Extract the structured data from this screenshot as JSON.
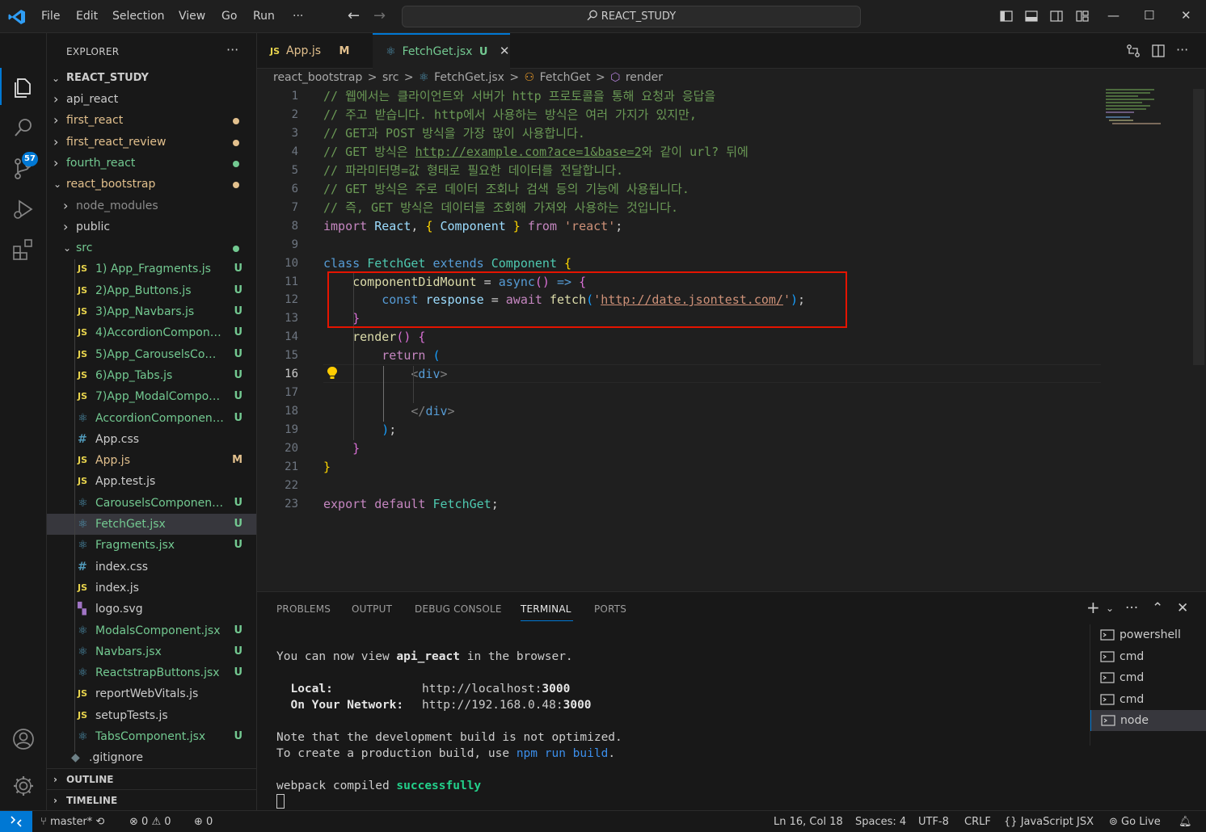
{
  "titlebar": {
    "menu": [
      "File",
      "Edit",
      "Selection",
      "View",
      "Go",
      "Run",
      "···"
    ],
    "search_text": "REACT_STUDY"
  },
  "activity": {
    "source_control_badge": "57"
  },
  "sidebar": {
    "title": "EXPLORER",
    "more": "···",
    "root": "REACT_STUDY",
    "tree": [
      {
        "label": "api_react",
        "type": "folder",
        "depth": 1,
        "expanded": false,
        "status": "",
        "dot": ""
      },
      {
        "label": "first_react",
        "type": "folder",
        "depth": 1,
        "expanded": false,
        "status": "",
        "dot": "#e2c08d"
      },
      {
        "label": "first_react_review",
        "type": "folder",
        "depth": 1,
        "expanded": false,
        "status": "",
        "dot": "#e2c08d"
      },
      {
        "label": "fourth_react",
        "type": "folder",
        "depth": 1,
        "expanded": false,
        "status": "",
        "dot": "#73c991"
      },
      {
        "label": "react_bootstrap",
        "type": "folder",
        "depth": 1,
        "expanded": true,
        "status": "",
        "dot": "#e2c08d"
      },
      {
        "label": "node_modules",
        "type": "folder",
        "depth": 2,
        "expanded": false,
        "status": "",
        "dot": "",
        "dim": true
      },
      {
        "label": "public",
        "type": "folder",
        "depth": 2,
        "expanded": false,
        "status": "",
        "dot": ""
      },
      {
        "label": "src",
        "type": "folder",
        "depth": 2,
        "expanded": true,
        "status": "",
        "dot": "#73c991"
      },
      {
        "label": "1) App_Fragments.js",
        "type": "js",
        "depth": 3,
        "status": "U"
      },
      {
        "label": "2)App_Buttons.js",
        "type": "js",
        "depth": 3,
        "status": "U"
      },
      {
        "label": "3)App_Navbars.js",
        "type": "js",
        "depth": 3,
        "status": "U"
      },
      {
        "label": "4)AccordionCompone...",
        "type": "js",
        "depth": 3,
        "status": "U"
      },
      {
        "label": "5)App_CarouselsCom...",
        "type": "js",
        "depth": 3,
        "status": "U"
      },
      {
        "label": "6)App_Tabs.js",
        "type": "js",
        "depth": 3,
        "status": "U"
      },
      {
        "label": "7)App_ModalCompon...",
        "type": "js",
        "depth": 3,
        "status": "U"
      },
      {
        "label": "AccordionComponent...",
        "type": "react",
        "depth": 3,
        "status": "U"
      },
      {
        "label": "App.css",
        "type": "css",
        "depth": 3,
        "status": ""
      },
      {
        "label": "App.js",
        "type": "js",
        "depth": 3,
        "status": "M"
      },
      {
        "label": "App.test.js",
        "type": "js",
        "depth": 3,
        "status": ""
      },
      {
        "label": "CarouselsComponent...",
        "type": "react",
        "depth": 3,
        "status": "U"
      },
      {
        "label": "FetchGet.jsx",
        "type": "react",
        "depth": 3,
        "status": "U",
        "selected": true
      },
      {
        "label": "Fragments.jsx",
        "type": "react",
        "depth": 3,
        "status": "U"
      },
      {
        "label": "index.css",
        "type": "css",
        "depth": 3,
        "status": ""
      },
      {
        "label": "index.js",
        "type": "js",
        "depth": 3,
        "status": ""
      },
      {
        "label": "logo.svg",
        "type": "svg",
        "depth": 3,
        "status": ""
      },
      {
        "label": "ModalsComponent.jsx",
        "type": "react",
        "depth": 3,
        "status": "U"
      },
      {
        "label": "Navbars.jsx",
        "type": "react",
        "depth": 3,
        "status": "U"
      },
      {
        "label": "ReactstrapButtons.jsx",
        "type": "react",
        "depth": 3,
        "status": "U"
      },
      {
        "label": "reportWebVitals.js",
        "type": "js",
        "depth": 3,
        "status": ""
      },
      {
        "label": "setupTests.js",
        "type": "js",
        "depth": 3,
        "status": ""
      },
      {
        "label": "TabsComponent.jsx",
        "type": "react",
        "depth": 3,
        "status": "U"
      },
      {
        "label": ".gitignore",
        "type": "git",
        "depth": 2,
        "status": ""
      }
    ],
    "outline": "OUTLINE",
    "timeline": "TIMELINE"
  },
  "tabs": [
    {
      "icon": "JS",
      "label": "App.js",
      "status": "M",
      "active": false
    },
    {
      "icon": "⚛",
      "label": "FetchGet.jsx",
      "status": "U",
      "active": true
    }
  ],
  "breadcrumb": [
    "react_bootstrap",
    ">",
    "src",
    ">",
    "⚛",
    "FetchGet.jsx",
    ">",
    "FetchGet",
    ">",
    "render"
  ],
  "editor": {
    "current_line": 16,
    "lines": [
      [
        [
          "tok-comment",
          "// 웹에서는 클라이언트와 서버가 http 프로토콜을 통해 요청과 응답을"
        ]
      ],
      [
        [
          "tok-comment",
          "// 주고 받습니다. http에서 사용하는 방식은 여러 가지가 있지만,"
        ]
      ],
      [
        [
          "tok-comment",
          "// GET과 POST 방식을 가장 많이 사용합니다."
        ]
      ],
      [
        [
          "tok-comment",
          "// GET 방식은 "
        ],
        [
          "tok-comment tok-url",
          "http://example.com?ace=1&base=2"
        ],
        [
          "tok-comment",
          "와 같이 url? 뒤에"
        ]
      ],
      [
        [
          "tok-comment",
          "// 파라미터명=값 형태로 필요한 데이터를 전달합니다."
        ]
      ],
      [
        [
          "tok-comment",
          "// GET 방식은 주로 데이터 조회나 검색 등의 기능에 사용됩니다."
        ]
      ],
      [
        [
          "tok-comment",
          "// 즉, GET 방식은 데이터를 조회해 가져와 사용하는 것입니다."
        ]
      ],
      [
        [
          "tok-kw",
          "import "
        ],
        [
          "tok-var",
          "React"
        ],
        [
          "tok-punc",
          ", "
        ],
        [
          "tok-brace1",
          "{ "
        ],
        [
          "tok-var",
          "Component"
        ],
        [
          "tok-brace1",
          " }"
        ],
        [
          "tok-kw",
          " from "
        ],
        [
          "tok-str",
          "'react'"
        ],
        [
          "tok-punc",
          ";"
        ]
      ],
      [],
      [
        [
          "tok-kw2",
          "class "
        ],
        [
          "tok-cls",
          "FetchGet "
        ],
        [
          "tok-kw2",
          "extends "
        ],
        [
          "tok-cls",
          "Component "
        ],
        [
          "tok-brace1",
          "{"
        ]
      ],
      [
        [
          "tok-punc",
          "    "
        ],
        [
          "tok-fn",
          "componentDidMount"
        ],
        [
          "tok-punc",
          " = "
        ],
        [
          "tok-kw2",
          "async"
        ],
        [
          "tok-brace2",
          "()"
        ],
        [
          "tok-kw2",
          " => "
        ],
        [
          "tok-brace2",
          "{"
        ]
      ],
      [
        [
          "tok-punc",
          "        "
        ],
        [
          "tok-kw2",
          "const "
        ],
        [
          "tok-var",
          "response"
        ],
        [
          "tok-punc",
          " = "
        ],
        [
          "tok-kw",
          "await "
        ],
        [
          "tok-fn",
          "fetch"
        ],
        [
          "tok-brace3",
          "("
        ],
        [
          "tok-str",
          "'"
        ],
        [
          "tok-str tok-url",
          "http://date.jsontest.com/"
        ],
        [
          "tok-str",
          "'"
        ],
        [
          "tok-brace3",
          ")"
        ],
        [
          "tok-punc",
          ";"
        ]
      ],
      [
        [
          "tok-punc",
          "    "
        ],
        [
          "tok-brace2",
          "}"
        ]
      ],
      [
        [
          "tok-punc",
          "    "
        ],
        [
          "tok-fn",
          "render"
        ],
        [
          "tok-brace2",
          "()"
        ],
        [
          "tok-punc",
          " "
        ],
        [
          "tok-brace2",
          "{"
        ]
      ],
      [
        [
          "tok-punc",
          "        "
        ],
        [
          "tok-kw",
          "return "
        ],
        [
          "tok-brace3",
          "("
        ]
      ],
      [
        [
          "tok-punc",
          "            "
        ],
        [
          "tok-tagb",
          "<"
        ],
        [
          "tok-tag",
          "div"
        ],
        [
          "tok-tagb",
          ">"
        ]
      ],
      [],
      [
        [
          "tok-punc",
          "            "
        ],
        [
          "tok-tagb",
          "</"
        ],
        [
          "tok-tag",
          "div"
        ],
        [
          "tok-tagb",
          ">"
        ]
      ],
      [
        [
          "tok-punc",
          "        "
        ],
        [
          "tok-brace3",
          ")"
        ],
        [
          "tok-punc",
          ";"
        ]
      ],
      [
        [
          "tok-punc",
          "    "
        ],
        [
          "tok-brace2",
          "}"
        ]
      ],
      [
        [
          "tok-brace1",
          "}"
        ]
      ],
      [],
      [
        [
          "tok-kw",
          "export "
        ],
        [
          "tok-kw",
          "default "
        ],
        [
          "tok-cls",
          "FetchGet"
        ],
        [
          "tok-punc",
          ";"
        ]
      ]
    ]
  },
  "panel": {
    "tabs": [
      "PROBLEMS",
      "OUTPUT",
      "DEBUG CONSOLE",
      "TERMINAL",
      "PORTS"
    ],
    "active_tab": "TERMINAL",
    "terminal": {
      "line1_pre": "You can now view ",
      "line1_bold": "api_react",
      "line1_post": " in the browser.",
      "local_label": "  Local:",
      "local_url_pre": "http://localhost:",
      "local_port": "3000",
      "network_label": "  On Your Network:",
      "network_url_pre": "http://192.168.0.48:",
      "network_port": "3000",
      "note1": "Note that the development build is not optimized.",
      "note2_pre": "To create a production build, use ",
      "note2_cmd": "npm run build",
      "note2_post": ".",
      "compiled_pre": "webpack compiled ",
      "compiled_status": "successfully"
    },
    "terminals": [
      {
        "label": "powershell",
        "active": false
      },
      {
        "label": "cmd",
        "active": false
      },
      {
        "label": "cmd",
        "active": false
      },
      {
        "label": "cmd",
        "active": false
      },
      {
        "label": "node",
        "active": true
      }
    ]
  },
  "statusbar": {
    "branch": "master*",
    "errors": "0",
    "warnings": "0",
    "ports": "0",
    "position": "Ln 16, Col 18",
    "spaces": "Spaces: 4",
    "encoding": "UTF-8",
    "eol": "CRLF",
    "language": "JavaScript JSX",
    "golive": "Go Live"
  },
  "colors": {
    "accent": "#0078d4",
    "highlight_box": "#e51400"
  }
}
